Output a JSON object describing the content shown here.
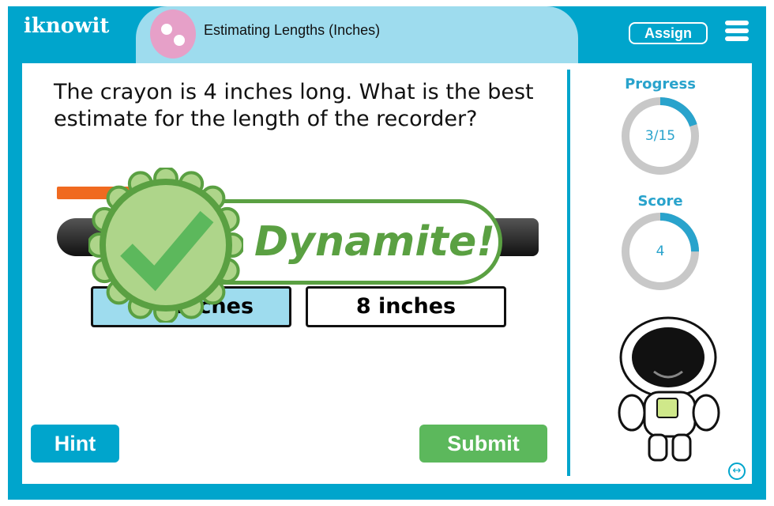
{
  "header": {
    "logo": "iknowit",
    "title": "Estimating Lengths (Inches)",
    "assign_label": "Assign",
    "menu_icon": "hamburger-icon"
  },
  "question": {
    "text": "The crayon is 4 inches long. What is the best estimate for the length of the recorder?"
  },
  "answers": [
    {
      "label": "inches",
      "selected": true
    },
    {
      "label": "8 inches",
      "selected": false
    }
  ],
  "feedback": {
    "text": "Dynamite!",
    "icon": "checkmark-badge-icon",
    "color": "#5aa042"
  },
  "sidebar": {
    "progress_label": "Progress",
    "progress_value": "3/15",
    "progress_fraction": 0.2,
    "score_label": "Score",
    "score_value": "4",
    "score_fraction": 0.25
  },
  "buttons": {
    "hint": "Hint",
    "submit": "Submit"
  },
  "colors": {
    "brand": "#00a5cc",
    "title_bg": "#9edcee",
    "submit": "#5cb85c"
  }
}
